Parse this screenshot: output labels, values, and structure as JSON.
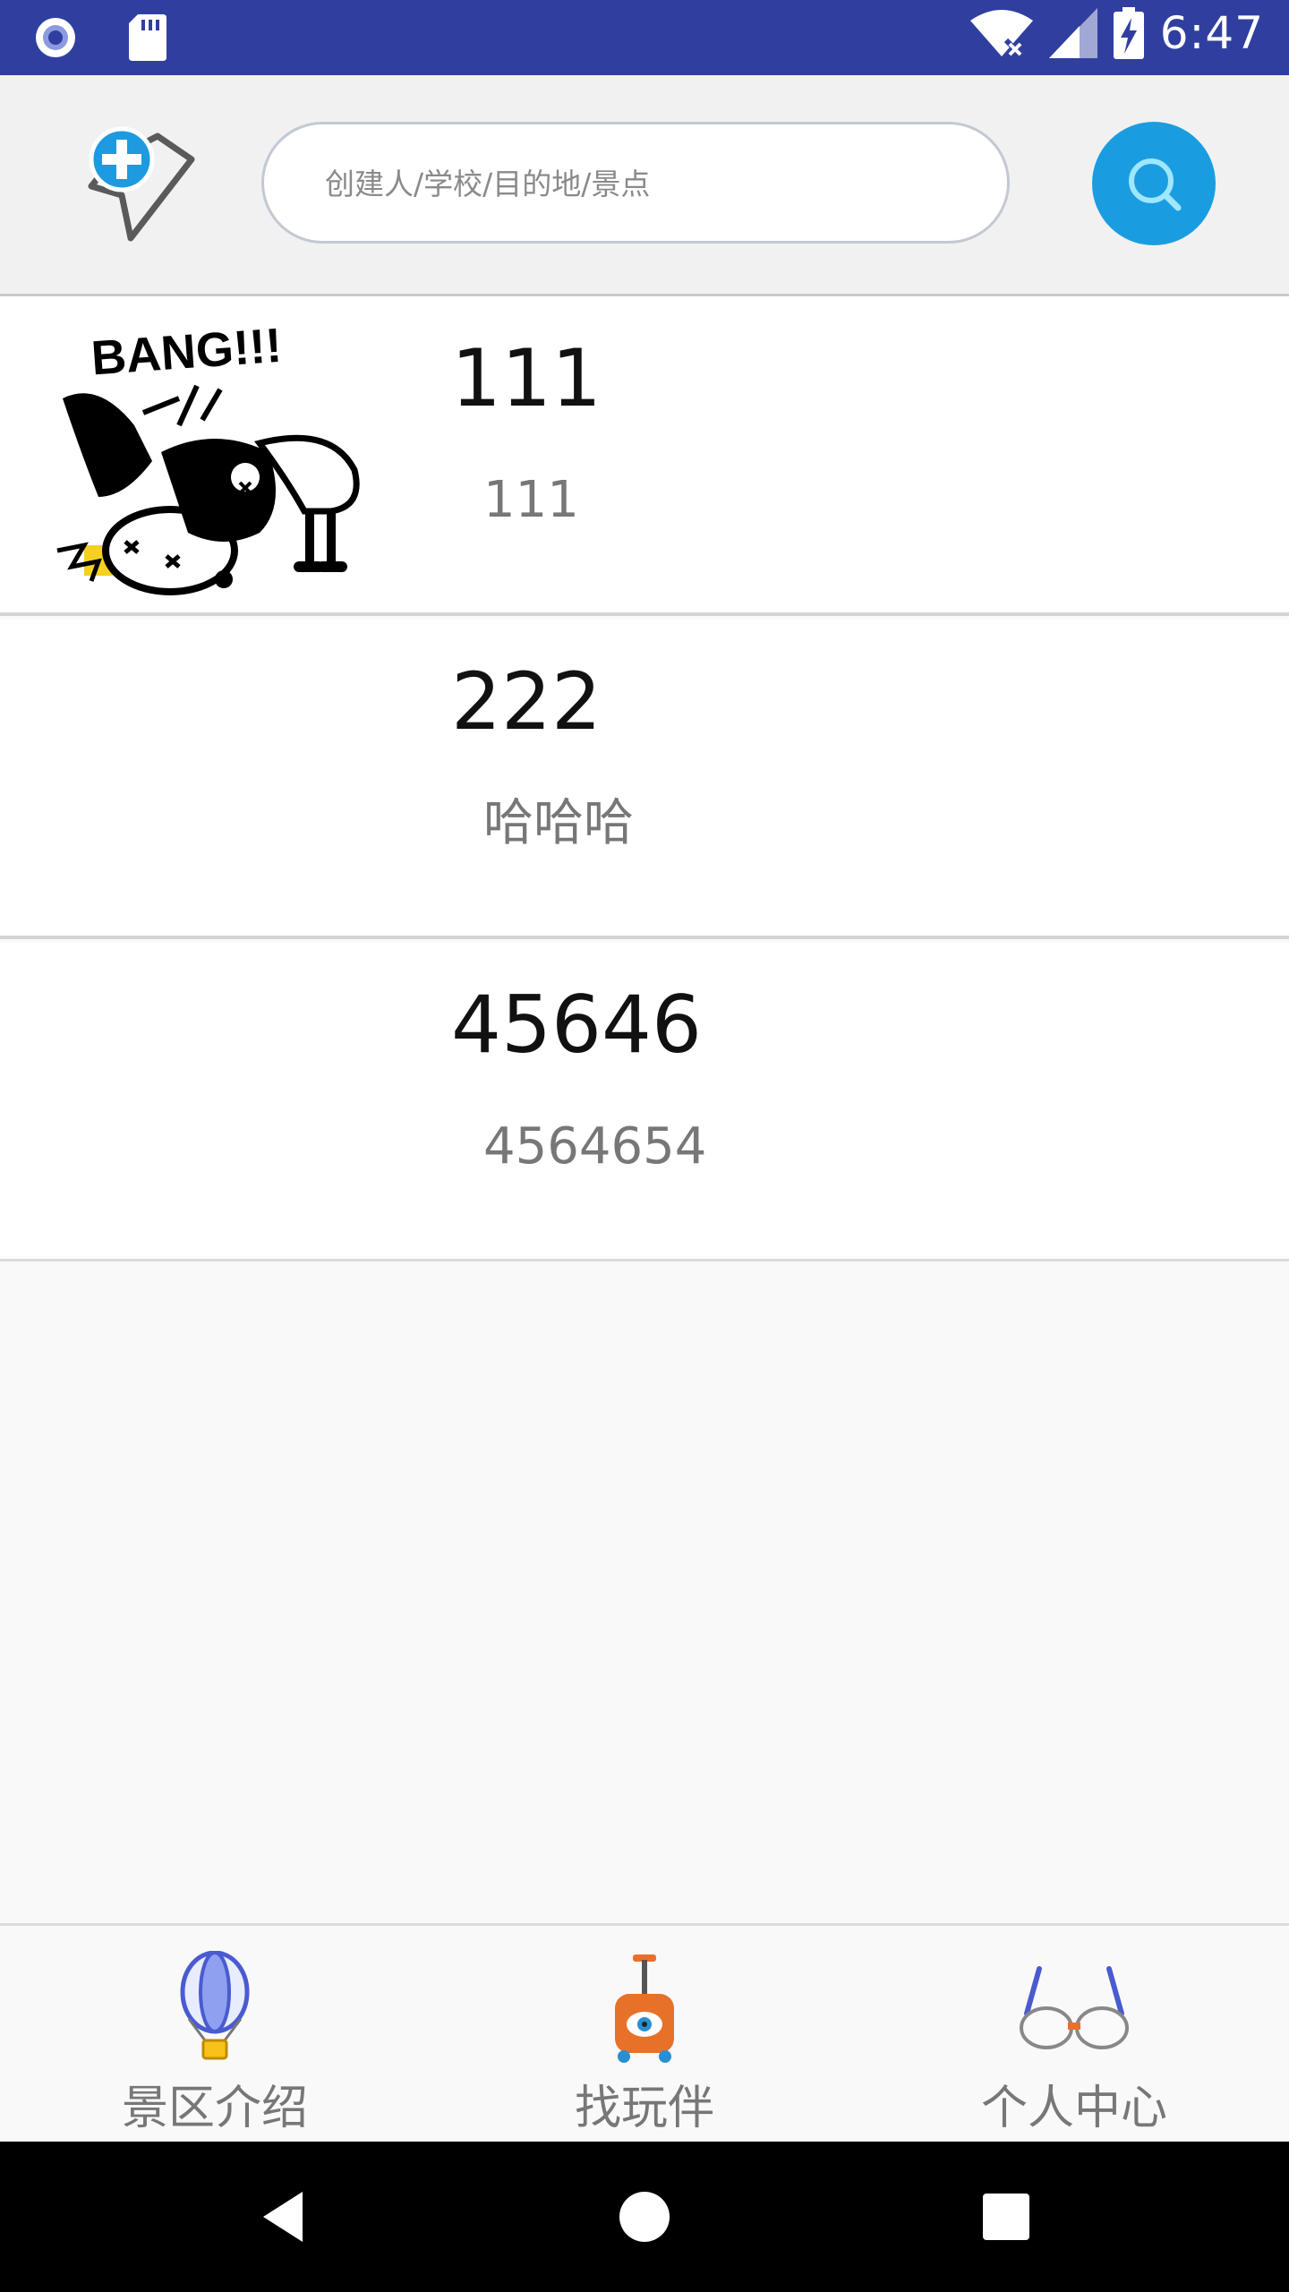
{
  "status_bar": {
    "time": "6:47",
    "icons": [
      "notification-circle-icon",
      "sd-card-icon",
      "wifi-icon",
      "signal-icon",
      "battery-charging-icon"
    ],
    "background": "#303f9f"
  },
  "search": {
    "placeholder": "创建人/学校/目的地/景点",
    "value": "",
    "button_color": "#1a9de0"
  },
  "list": {
    "items": [
      {
        "title": "111",
        "subtitle": "111",
        "has_image": true,
        "image": "cartoon-bang-image"
      },
      {
        "title": "222",
        "subtitle": "哈哈哈",
        "has_image": false
      },
      {
        "title": "45646",
        "subtitle": "4564654",
        "has_image": false
      }
    ]
  },
  "bottom_nav": {
    "items": [
      {
        "label": "景区介绍",
        "icon": "hot-air-balloon-icon"
      },
      {
        "label": "找玩伴",
        "icon": "luggage-icon"
      },
      {
        "label": "个人中心",
        "icon": "glasses-icon"
      }
    ]
  },
  "system_nav": {
    "buttons": [
      "back-icon",
      "home-icon",
      "recents-icon"
    ]
  }
}
